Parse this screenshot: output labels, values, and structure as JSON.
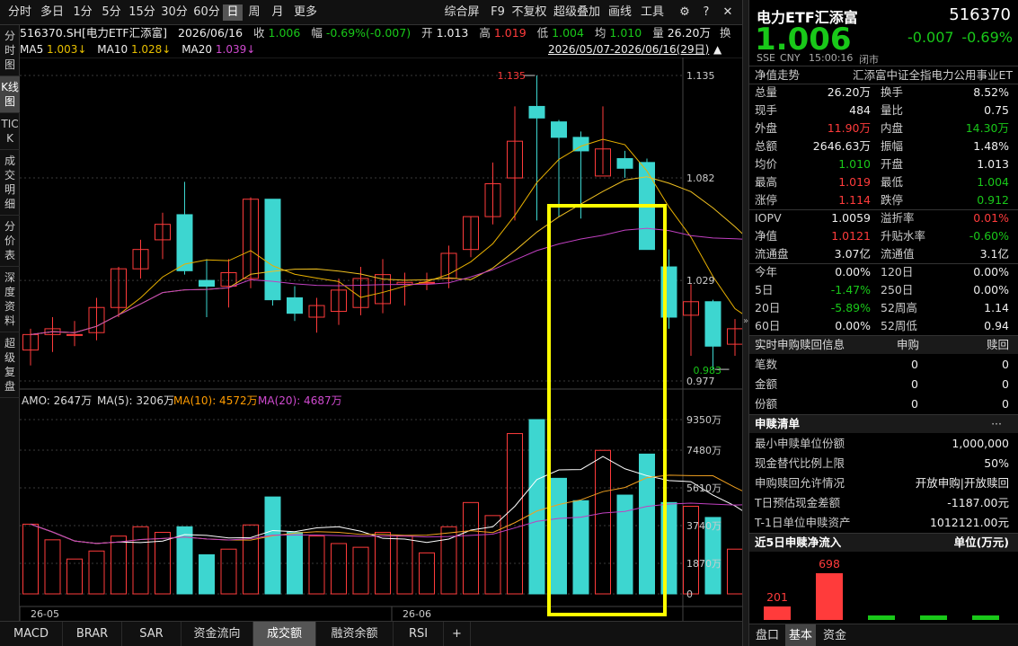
{
  "toolbar": {
    "periods": [
      "分时",
      "多日",
      "1分",
      "5分",
      "15分",
      "30分",
      "60分",
      "日",
      "周",
      "月",
      "更多"
    ],
    "selected": "日",
    "right": [
      "综合屏",
      "F9",
      "不复权",
      "超级叠加",
      "画线",
      "工具"
    ]
  },
  "left_tabs": [
    "分时图",
    "K线图",
    "TICK",
    "成交明细",
    "分价表",
    "深度资料",
    "超级复盘"
  ],
  "left_tab_selected": "K线图",
  "info": {
    "symbol": "516370.SH[电力ETF汇添富]",
    "date": "2026/06/16",
    "close_label": "收",
    "close": "1.006",
    "change_label": "幅",
    "change": "-0.69%(-0.007)",
    "open_label": "开",
    "open": "1.013",
    "high_label": "高",
    "high": "1.019",
    "low_label": "低",
    "low": "1.004",
    "avg_label": "均",
    "avg": "1.010",
    "vol_label": "量",
    "vol": "26.20万",
    "switch_label": "换"
  },
  "ma_line": {
    "ma5_label": "MA5",
    "ma5": "1.003↓",
    "ma10_label": "MA10",
    "ma10": "1.028↓",
    "ma20_label": "MA20",
    "ma20": "1.039↓",
    "range": "2026/05/07-2026/06/16(29日)"
  },
  "vol_line": {
    "amo": "AMO: 2647万",
    "ma5": "MA(5): 3206万",
    "ma10": "MA(10): 4572万",
    "ma20": "MA(20): 4687万"
  },
  "colors": {
    "up": "#ff3b3b",
    "down": "#3dd6d0",
    "ma5": "#ffffff",
    "ma10": "#f0a020",
    "ma20": "#c040c0",
    "highlight": "#ffff00"
  },
  "chart_data": {
    "type": "candlestick",
    "price_ticks": [
      "1.135",
      "1.082",
      "1.029",
      "0.977"
    ],
    "price_range": [
      0.977,
      1.135
    ],
    "volume_ticks": [
      "9350万",
      "7480万",
      "5610万",
      "3740万",
      "1870万",
      "0"
    ],
    "volume_max": 9350,
    "x_labels": [
      "26-05",
      "26-06"
    ],
    "max_label": "1.135",
    "min_label": "0.983",
    "candles": [
      {
        "o": 0.993,
        "h": 1.004,
        "l": 0.985,
        "c": 1.001,
        "v": 3740
      },
      {
        "o": 1.001,
        "h": 1.01,
        "l": 0.992,
        "c": 1.004,
        "v": 2900
      },
      {
        "o": 1.001,
        "h": 1.008,
        "l": 0.995,
        "c": 1.001,
        "v": 1870
      },
      {
        "o": 1.002,
        "h": 1.02,
        "l": 0.998,
        "c": 1.015,
        "v": 2300
      },
      {
        "o": 1.015,
        "h": 1.036,
        "l": 1.01,
        "c": 1.035,
        "v": 3100
      },
      {
        "o": 1.035,
        "h": 1.05,
        "l": 1.03,
        "c": 1.045,
        "v": 3600
      },
      {
        "o": 1.05,
        "h": 1.064,
        "l": 1.04,
        "c": 1.058,
        "v": 3300
      },
      {
        "o": 1.063,
        "h": 1.08,
        "l": 1.032,
        "c": 1.034,
        "v": 3600
      },
      {
        "o": 1.029,
        "h": 1.04,
        "l": 1.01,
        "c": 1.026,
        "v": 2100
      },
      {
        "o": 1.026,
        "h": 1.04,
        "l": 1.015,
        "c": 1.033,
        "v": 2400
      },
      {
        "o": 1.03,
        "h": 1.072,
        "l": 1.025,
        "c": 1.071,
        "v": 3700
      },
      {
        "o": 1.071,
        "h": 1.071,
        "l": 1.016,
        "c": 1.019,
        "v": 5200
      },
      {
        "o": 1.02,
        "h": 1.026,
        "l": 1.008,
        "c": 1.012,
        "v": 3300
      },
      {
        "o": 1.01,
        "h": 1.02,
        "l": 1.002,
        "c": 1.016,
        "v": 3100
      },
      {
        "o": 1.013,
        "h": 1.03,
        "l": 1.006,
        "c": 1.024,
        "v": 2700
      },
      {
        "o": 1.015,
        "h": 1.036,
        "l": 1.011,
        "c": 1.03,
        "v": 2500
      },
      {
        "o": 1.017,
        "h": 1.04,
        "l": 1.012,
        "c": 1.032,
        "v": 3300
      },
      {
        "o": 1.027,
        "h": 1.033,
        "l": 1.016,
        "c": 1.028,
        "v": 3100
      },
      {
        "o": 1.028,
        "h": 1.033,
        "l": 1.024,
        "c": 1.028,
        "v": 2200
      },
      {
        "o": 1.03,
        "h": 1.047,
        "l": 1.025,
        "c": 1.043,
        "v": 3600
      },
      {
        "o": 1.045,
        "h": 1.062,
        "l": 1.041,
        "c": 1.062,
        "v": 4900
      },
      {
        "o": 1.062,
        "h": 1.09,
        "l": 1.058,
        "c": 1.079,
        "v": 4200
      },
      {
        "o": 1.082,
        "h": 1.119,
        "l": 1.06,
        "c": 1.101,
        "v": 8600
      },
      {
        "o": 1.119,
        "h": 1.135,
        "l": 1.06,
        "c": 1.113,
        "v": 9350
      },
      {
        "o": 1.111,
        "h": 1.112,
        "l": 1.062,
        "c": 1.103,
        "v": 6200
      },
      {
        "o": 1.103,
        "h": 1.106,
        "l": 1.061,
        "c": 1.096,
        "v": 5000
      },
      {
        "o": 1.083,
        "h": 1.119,
        "l": 1.084,
        "c": 1.097,
        "v": 7700
      },
      {
        "o": 1.092,
        "h": 1.096,
        "l": 1.082,
        "c": 1.087,
        "v": 5300
      },
      {
        "o": 1.09,
        "h": 1.092,
        "l": 1.045,
        "c": 1.045,
        "v": 7500
      },
      {
        "o": 1.036,
        "h": 1.045,
        "l": 1.004,
        "c": 1.01,
        "v": 4900
      },
      {
        "o": 1.011,
        "h": 1.027,
        "l": 0.99,
        "c": 1.018,
        "v": 4700
      },
      {
        "o": 1.018,
        "h": 1.019,
        "l": 0.983,
        "c": 0.995,
        "v": 4100
      },
      {
        "o": 0.996,
        "h": 1.009,
        "l": 0.99,
        "c": 1.004,
        "v": 2400
      },
      {
        "o": 1.002,
        "h": 1.008,
        "l": 0.997,
        "c": 1.006,
        "v": 3700
      },
      {
        "o": 1.006,
        "h": 1.013,
        "l": 1.0,
        "c": 1.013,
        "v": 3300
      },
      {
        "o": 1.013,
        "h": 1.019,
        "l": 1.004,
        "c": 1.006,
        "v": 2647
      }
    ]
  },
  "panel": {
    "name": "电力ETF汇添富",
    "code": "516370",
    "price": "1.006",
    "change": "-0.007",
    "change_pct": "-0.69%",
    "exchange": "SSE",
    "currency": "CNY",
    "time": "15:00:16",
    "status": "闭市",
    "trend_label": "净值走势",
    "index_name": "汇添富中证全指电力公用事业ET",
    "quote_rows": [
      [
        "总量",
        "26.20万",
        "",
        "换手",
        "8.52%",
        ""
      ],
      [
        "现手",
        "484",
        "",
        "量比",
        "0.75",
        ""
      ],
      [
        "外盘",
        "11.90万",
        "red",
        "内盘",
        "14.30万",
        "green"
      ],
      [
        "总额",
        "2646.63万",
        "",
        "振幅",
        "1.48%",
        ""
      ],
      [
        "均价",
        "1.010",
        "green",
        "开盘",
        "1.013",
        ""
      ],
      [
        "最高",
        "1.019",
        "red",
        "最低",
        "1.004",
        "green"
      ],
      [
        "涨停",
        "1.114",
        "red",
        "跌停",
        "0.912",
        "green"
      ]
    ],
    "iopv_rows": [
      [
        "IOPV",
        "1.0059",
        "",
        "溢折率",
        "0.01%",
        "red"
      ],
      [
        "净值",
        "1.0121",
        "red",
        "升贴水率",
        "-0.60%",
        "green"
      ],
      [
        "流通盘",
        "3.07亿",
        "",
        "流通值",
        "3.1亿",
        ""
      ]
    ],
    "period_rows": [
      [
        "今年",
        "0.00%",
        "",
        "120日",
        "0.00%",
        ""
      ],
      [
        "5日",
        "-1.47%",
        "green",
        "250日",
        "0.00%",
        ""
      ],
      [
        "20日",
        "-5.89%",
        "green",
        "52周高",
        "1.14",
        ""
      ],
      [
        "60日",
        "0.00%",
        "",
        "52周低",
        "0.94",
        ""
      ]
    ],
    "redeem_header": [
      "实时申购赎回信息",
      "申购",
      "赎回"
    ],
    "redeem_rows": [
      [
        "笔数",
        "0",
        "0"
      ],
      [
        "金额",
        "0",
        "0"
      ],
      [
        "份额",
        "0",
        "0"
      ]
    ],
    "list_header": "申赎清单",
    "list_more": "···",
    "list_rows": [
      [
        "最小申赎单位份额",
        "1,000,000"
      ],
      [
        "现金替代比例上限",
        "50%"
      ],
      [
        "申购赎回允许情况",
        "开放申购|开放赎回"
      ],
      [
        "T日预估现金差额",
        "-1187.00元"
      ],
      [
        "T-1日单位申赎资产",
        "1012121.00元"
      ]
    ],
    "flow_title": "近5日申赎净流入",
    "flow_unit": "单位(万元)",
    "flow_values": [
      201,
      698,
      0,
      0,
      0
    ],
    "flow_labels": [
      "201",
      "698"
    ]
  },
  "bottom_tabs": [
    "MACD",
    "BRAR",
    "SAR",
    "资金流向",
    "成交额",
    "融资余额",
    "RSI",
    "+"
  ],
  "bottom_selected": "成交额",
  "right_tabs": [
    "盘口",
    "基本",
    "资金"
  ],
  "right_selected": "基本"
}
